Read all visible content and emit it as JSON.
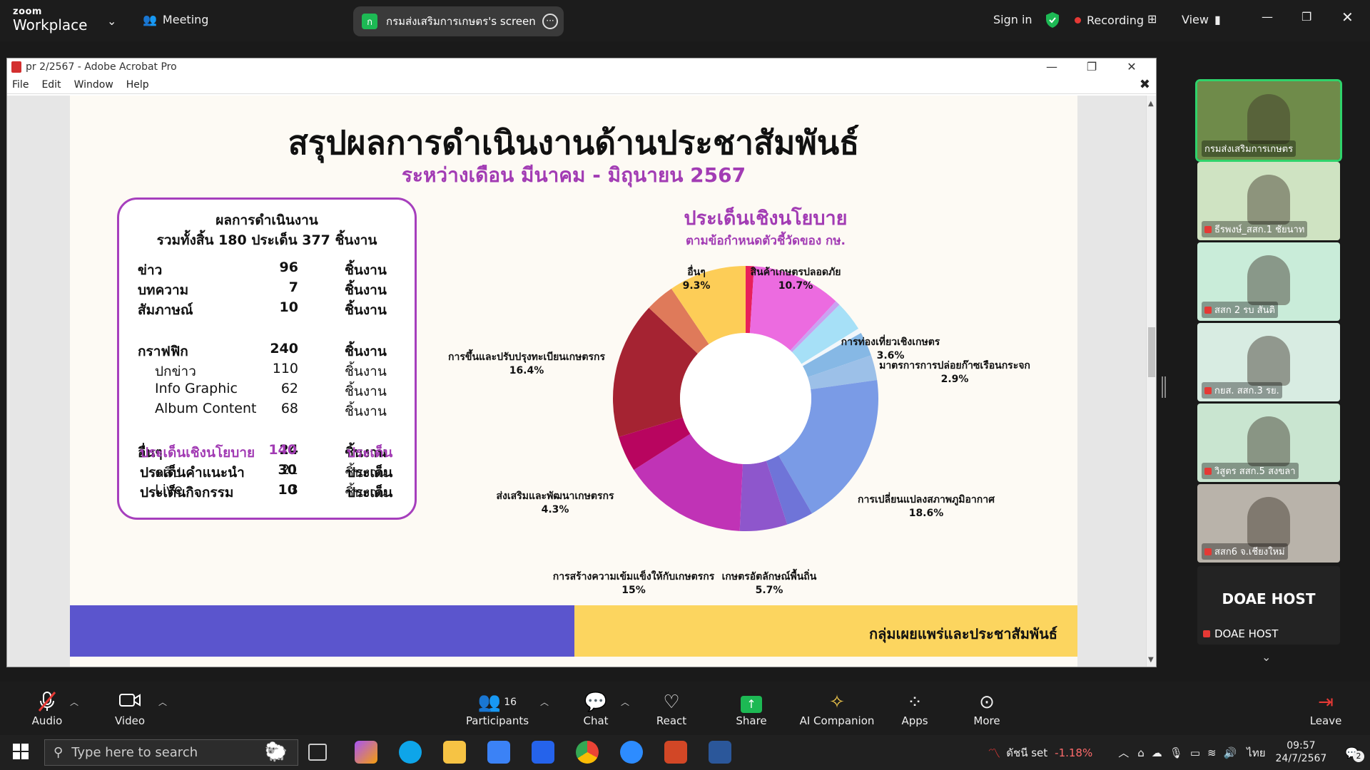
{
  "zoom": {
    "brand_top": "zoom",
    "brand_bottom": "Workplace",
    "meeting_label": "Meeting",
    "share_initial": "ก",
    "share_label": "กรมส่งเสริมการเกษตร's screen",
    "sign_in": "Sign in",
    "recording": "Recording",
    "view": "View"
  },
  "acrobat": {
    "title": "pr 2/2567 - Adobe Acrobat Pro",
    "menu": [
      "File",
      "Edit",
      "Window",
      "Help"
    ]
  },
  "slide": {
    "title": "สรุปผลการดำเนินงานด้านประชาสัมพันธ์",
    "subtitle": "ระหว่างเดือน มีนาคม - มิถุนายน 2567",
    "summary_h1": "ผลการดำเนินงาน",
    "summary_h2": "รวมทั้งสิ้น 180 ประเด็น 377 ชิ้นงาน",
    "rows": [
      {
        "label": "ข่าว",
        "value": "96",
        "unit": "ชิ้นงาน"
      },
      {
        "label": "บทความ",
        "value": "7",
        "unit": "ชิ้นงาน"
      },
      {
        "label": "สัมภาษณ์",
        "value": "10",
        "unit": "ชิ้นงาน"
      },
      {
        "label": "กราฟฟิก",
        "value": "240",
        "unit": "ชิ้นงาน"
      },
      {
        "label": "ปกข่าว",
        "value": "110",
        "unit": "ชิ้นงาน"
      },
      {
        "label": "Info Graphic",
        "value": "62",
        "unit": "ชิ้นงาน"
      },
      {
        "label": "Album Content",
        "value": "68",
        "unit": "ชิ้นงาน"
      },
      {
        "label": "อื่นๆ",
        "value": "24",
        "unit": "ชิ้นงาน"
      },
      {
        "label": "คลิป",
        "value": "21",
        "unit": "ชิ้นงาน"
      },
      {
        "label": "Live",
        "value": "3",
        "unit": "ชิ้นงาน"
      }
    ],
    "policy_rows": [
      {
        "label": "ประเด็นเชิงนโยบาย",
        "value": "140",
        "unit": "ประเด็น",
        "color": "#a23cb4"
      },
      {
        "label": "ประเด็นคำแนะนำ",
        "value": "30",
        "unit": "ประเด็น",
        "color": "#111111"
      },
      {
        "label": "ประเด็นกิจกรรม",
        "value": "10",
        "unit": "ประเด็น",
        "color": "#111111"
      }
    ],
    "banner": "กลุ่มเผยแพร่และประชาสัมพันธ์"
  },
  "chart_data": {
    "type": "pie",
    "title": "ประเด็นเชิงนโยบาย",
    "subtitle": "ตามข้อกำหนดตัวชี้วัดของ กษ.",
    "slices": [
      {
        "label": "",
        "value": 1.0,
        "color": "#e8205a",
        "pct": ""
      },
      {
        "label": "สินค้าเกษตรปลอดภัย",
        "value": 10.7,
        "color": "#ec6be0",
        "pct": "10.7%"
      },
      {
        "label": "",
        "value": 0.6,
        "color": "#c9a2f2",
        "pct": ""
      },
      {
        "label": "การท่องเที่ยวเชิงเกษตร",
        "value": 3.6,
        "color": "#a6e0f7",
        "pct": "3.6%"
      },
      {
        "label": "",
        "value": 0.6,
        "color": "#f2f7fb",
        "pct": ""
      },
      {
        "label": "มาตรการการปล่อยก๊าซเรือนกระจก",
        "value": 2.9,
        "color": "#86b8e5",
        "pct": "2.9%"
      },
      {
        "label": "",
        "value": 3.0,
        "color": "#9cc0e8",
        "pct": ""
      },
      {
        "label": "การเปลี่ยนแปลงสภาพภูมิอากาศ",
        "value": 18.6,
        "color": "#7a9be6",
        "pct": "18.6%"
      },
      {
        "label": "",
        "value": 3.2,
        "color": "#6f74d8",
        "pct": ""
      },
      {
        "label": "เกษตรอัตลักษณ์พื้นถิ่น",
        "value": 5.7,
        "color": "#8e56cc",
        "pct": "5.7%"
      },
      {
        "label": "การสร้างความเข้มแข็งให้กับเกษตรกร",
        "value": 15.0,
        "color": "#c033b6",
        "pct": "15%"
      },
      {
        "label": "ส่งเสริมและพัฒนาเกษตรกร",
        "value": 4.3,
        "color": "#b8055f",
        "pct": "4.3%"
      },
      {
        "label": "การขึ้นและปรับปรุงทะเบียนเกษตรกร",
        "value": 16.4,
        "color": "#a52332",
        "pct": "16.4%"
      },
      {
        "label": "",
        "value": 3.5,
        "color": "#df7a5a",
        "pct": ""
      },
      {
        "label": "อื่นๆ",
        "value": 9.3,
        "color": "#fdcd57",
        "pct": "9.3%"
      }
    ]
  },
  "participants": [
    {
      "name": "กรมส่งเสริมการเกษตร",
      "color": "#6f8b4a"
    },
    {
      "name": "ธีรพงษ์_สสก.1 ชัยนาท",
      "color": "#cfe3c2"
    },
    {
      "name": "สสก 2 รบ สันติ",
      "color": "#c9ecd9"
    },
    {
      "name": "กยส. สสก.3 รย.",
      "color": "#d8ece2"
    },
    {
      "name": "วิสูตร สสก.5 สงขลา",
      "color": "#c9e5d0"
    },
    {
      "name": "สสก6 จ.เชียงใหม่",
      "color": "#b9b3aa"
    }
  ],
  "host": {
    "big": "DOAE HOST",
    "name": "DOAE HOST"
  },
  "toolbar": {
    "audio": "Audio",
    "video": "Video",
    "participants": "Participants",
    "participants_count": "16",
    "chat": "Chat",
    "react": "React",
    "share": "Share",
    "ai": "AI Companion",
    "apps": "Apps",
    "more": "More",
    "leave": "Leave"
  },
  "taskbar": {
    "search_placeholder": "Type here to search",
    "stock_name": "ดัชนี set",
    "stock_change": "-1.18%",
    "lang": "ไทย",
    "time": "09:57",
    "date": "24/7/2567",
    "notif_count": "2"
  },
  "colors": {
    "accent_purple": "#a23cb4",
    "banner_blue": "#5b55cd",
    "banner_yellow": "#fcd55f",
    "recording_red": "#e53935",
    "share_green": "#1db954"
  }
}
